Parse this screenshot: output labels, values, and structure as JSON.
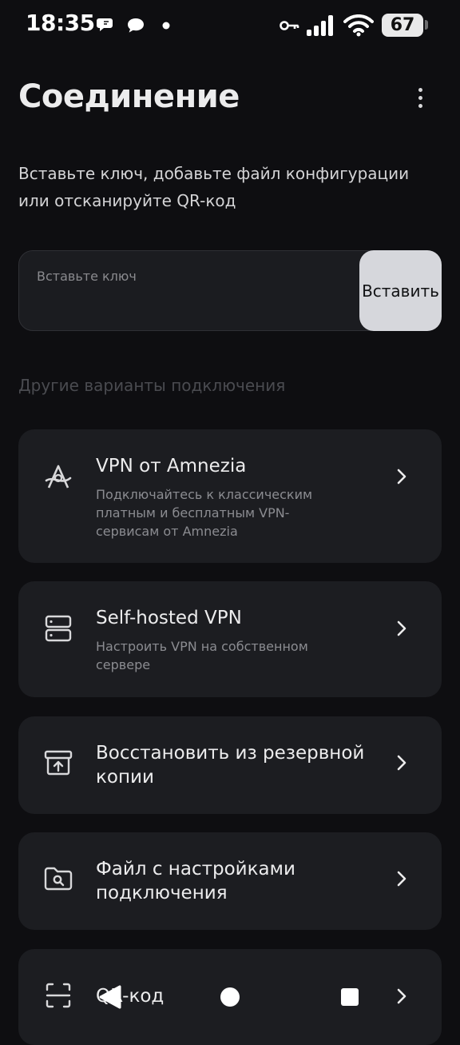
{
  "status_bar": {
    "time": "18:35",
    "battery": "67"
  },
  "header": {
    "title": "Соединение",
    "description": "Вставьте ключ, добавьте файл конфигурации или отсканируйте QR-код"
  },
  "key_input": {
    "placeholder": "Вставьте ключ",
    "value": "",
    "paste_label": "Вставить"
  },
  "other_options": {
    "section_title": "Другие варианты подключения",
    "items": [
      {
        "icon": "amnezia-logo-icon",
        "title": "VPN от Amnezia",
        "subtitle": "Подключайтесь к классическим платным и бесплатным VPN-сервисам от Amnezia"
      },
      {
        "icon": "server-icon",
        "title": "Self-hosted VPN",
        "subtitle": "Настроить VPN на собственном сервере"
      },
      {
        "icon": "archive-restore-icon",
        "title": "Восстановить из резервной копии",
        "subtitle": ""
      },
      {
        "icon": "folder-search-icon",
        "title": "Файл с настройками подключения",
        "subtitle": ""
      },
      {
        "icon": "qr-scan-icon",
        "title": "QR-код",
        "subtitle": ""
      }
    ]
  },
  "colors": {
    "background": "#0e0e11",
    "card": "#1c1d21",
    "paste_button": "#d6d7dc",
    "muted_text": "#8b8c91"
  }
}
